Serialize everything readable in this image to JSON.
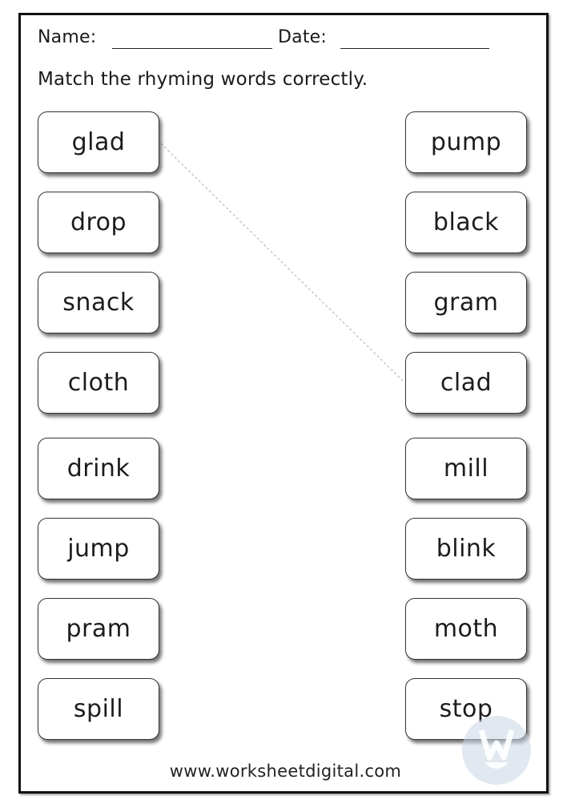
{
  "header": {
    "name_label": "Name:",
    "date_label": "Date:"
  },
  "instruction": "Match the rhyming words correctly.",
  "left_words": [
    "glad",
    "drop",
    "snack",
    "cloth",
    "drink",
    "jump",
    "pram",
    "spill"
  ],
  "right_words": [
    "pump",
    "black",
    "gram",
    "clad",
    "mill",
    "blink",
    "moth",
    "stop"
  ],
  "example_match": {
    "from": "glad",
    "to": "clad",
    "style": "dashed"
  },
  "footer": {
    "website": "www.worksheetdigital.com"
  },
  "watermark": {
    "icon": "worksheetdigital-logo-icon",
    "color": "#c8d6e4"
  }
}
